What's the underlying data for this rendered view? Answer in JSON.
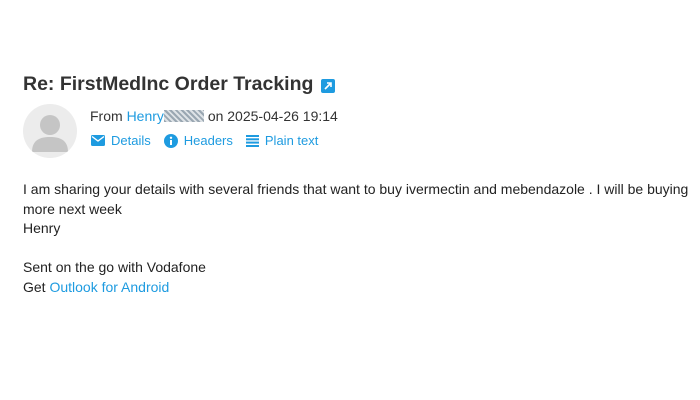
{
  "message": {
    "subject": "Re: FirstMedInc Order Tracking",
    "from": {
      "prefix": "From",
      "sender_name": "Henry",
      "date_text": "on 2025-04-26 19:14"
    },
    "actions": {
      "details": "Details",
      "headers": "Headers",
      "plain_text": "Plain text"
    },
    "body": {
      "paragraph": "I am sharing your details with several friends that want to buy ivermectin and mebendazole . I will be buying more next week",
      "signature": "Henry",
      "sent_line": "Sent on the go with Vodafone",
      "get_prefix": "Get",
      "get_link": "Outlook for Android"
    }
  },
  "colors": {
    "accent": "#1e9be0",
    "text": "#222222",
    "avatar_bg": "#ececec"
  },
  "icons": [
    "external-link-icon",
    "avatar-icon",
    "envelope-icon",
    "info-icon",
    "list-lines-icon"
  ]
}
